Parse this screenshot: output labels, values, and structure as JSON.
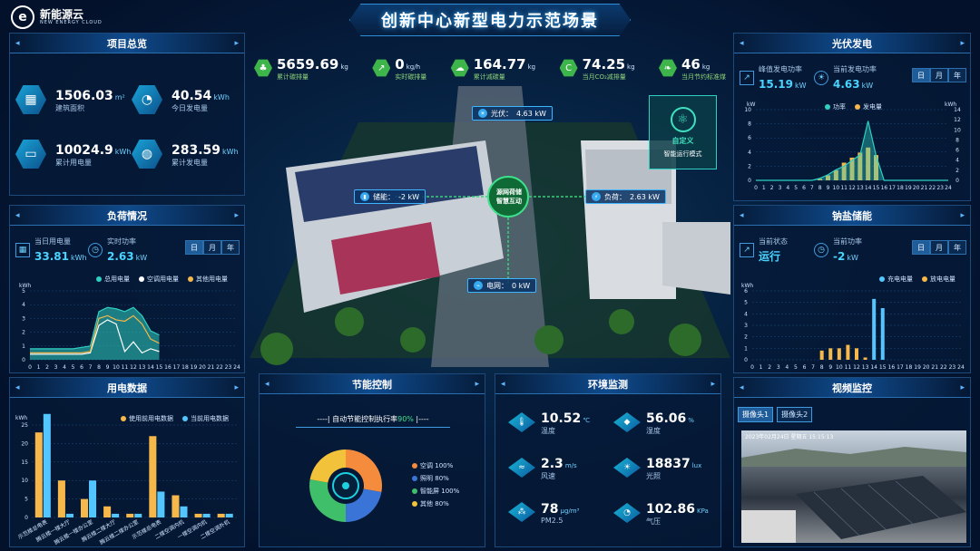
{
  "header": {
    "title": "创新中心新型电力示范场景",
    "logo_name": "新能源云",
    "logo_sub": "NEW ENERGY CLOUD"
  },
  "top_stats": [
    {
      "value": "5659.69",
      "unit": "kg",
      "label": "累计碳排量",
      "icon": "tree-icon"
    },
    {
      "value": "0",
      "unit": "kg/h",
      "label": "实时碳排量",
      "icon": "chart-icon"
    },
    {
      "value": "164.77",
      "unit": "kg",
      "label": "累计减碳量",
      "icon": "cloud-icon"
    },
    {
      "value": "74.25",
      "unit": "kg",
      "label": "当月CO₂减排量",
      "icon": "co2-icon"
    },
    {
      "value": "46",
      "unit": "kg",
      "label": "当月节约标准煤",
      "icon": "leaf-icon"
    }
  ],
  "project": {
    "title": "项目总览",
    "items": [
      {
        "value": "1506.03",
        "unit": "m²",
        "label": "建筑面积",
        "icon": "building-icon"
      },
      {
        "value": "40.54",
        "unit": "kWh",
        "label": "今日发电量",
        "icon": "meter-icon"
      },
      {
        "value": "10024.9",
        "unit": "kWh",
        "label": "累计用电量",
        "icon": "battery-icon"
      },
      {
        "value": "283.59",
        "unit": "kWh",
        "label": "累计发电量",
        "icon": "globe-icon"
      }
    ]
  },
  "load": {
    "title": "负荷情况",
    "today_label": "当日用电量",
    "today_value": "33.81",
    "today_unit": "kWh",
    "power_label": "实时功率",
    "power_value": "2.63",
    "power_unit": "kW",
    "tabs": [
      "日",
      "月",
      "年"
    ],
    "unit": "kWh",
    "legend": [
      "总用电量",
      "空调用电量",
      "其他用电量"
    ],
    "colors": [
      "#2fd0c2",
      "#ffffff",
      "#f6b84a"
    ]
  },
  "usage": {
    "title": "用电数据",
    "unit": "kWh",
    "legend": [
      "使用前用电数据",
      "当前用电数据"
    ],
    "colors": [
      "#f6b84a",
      "#53c6ff"
    ]
  },
  "control": {
    "title": "节能控制",
    "subtitle": "自动节能控制执行率",
    "rate": "90%",
    "items": [
      {
        "label": "空调",
        "value": "100%",
        "color": "#f58b3c"
      },
      {
        "label": "照明",
        "value": "80%",
        "color": "#3a74d6"
      },
      {
        "label": "智能屏",
        "value": "100%",
        "color": "#3fbf6a"
      },
      {
        "label": "其他",
        "value": "80%",
        "color": "#f2c23a"
      }
    ]
  },
  "env": {
    "title": "环境监测",
    "items": [
      {
        "value": "10.52",
        "unit": "℃",
        "label": "温度",
        "icon": "thermometer-icon"
      },
      {
        "value": "56.06",
        "unit": "%",
        "label": "湿度",
        "icon": "droplet-icon"
      },
      {
        "value": "2.3",
        "unit": "m/s",
        "label": "风速",
        "icon": "wind-icon"
      },
      {
        "value": "18837",
        "unit": "lux",
        "label": "光照",
        "icon": "sun-icon"
      },
      {
        "value": "78",
        "unit": "μg/m³",
        "label": "PM2.5",
        "icon": "dust-icon"
      },
      {
        "value": "102.86",
        "unit": "KPa",
        "label": "气压",
        "icon": "gauge-icon"
      }
    ]
  },
  "pv": {
    "title": "光伏发电",
    "peak_label": "峰值发电功率",
    "peak_value": "15.19",
    "peak_unit": "kW",
    "cur_label": "当前发电功率",
    "cur_value": "4.63",
    "cur_unit": "kW",
    "tabs": [
      "日",
      "月",
      "年"
    ],
    "unit_left": "kW",
    "unit_right": "kWh",
    "legend": [
      "功率",
      "发电量"
    ],
    "colors": [
      "#2fd0c2",
      "#f6b84a"
    ]
  },
  "storage": {
    "title": "钠盐储能",
    "state_label": "当前状态",
    "state_value": "运行",
    "power_label": "当前功率",
    "power_value": "-2",
    "power_unit": "kW",
    "tabs": [
      "日",
      "月",
      "年"
    ],
    "unit": "kWh",
    "legend": [
      "充电电量",
      "放电电量"
    ],
    "colors": [
      "#53c6ff",
      "#f6b84a"
    ]
  },
  "video": {
    "title": "视频监控",
    "tabs": [
      "摄像头1",
      "摄像头2"
    ],
    "timestamp": "2023年02月24日 星期五 15:15:13"
  },
  "scene": {
    "pv_label": "光伏：",
    "pv_value": "4.63 kW",
    "storage_label": "储能：",
    "storage_value": "-2 kW",
    "load_label": "负荷：",
    "load_value": "2.63 kW",
    "grid_label": "电网：",
    "grid_value": "0 kW",
    "center_line1": "源网荷储",
    "center_line2": "智慧互动",
    "mode_title": "自定义",
    "mode_label": "智能运行模式"
  },
  "chart_data": [
    {
      "type": "area",
      "title": "负荷情况",
      "ylabel": "kWh",
      "ylim": [
        0,
        5
      ],
      "x": [
        0,
        1,
        2,
        3,
        4,
        5,
        6,
        7,
        8,
        9,
        10,
        11,
        12,
        13,
        14,
        15
      ],
      "series": [
        {
          "name": "总用电量",
          "values": [
            0.8,
            0.8,
            0.8,
            0.8,
            0.8,
            0.8,
            0.9,
            1.0,
            3.5,
            3.8,
            3.7,
            3.5,
            3.8,
            3.2,
            2.1,
            1.8
          ]
        },
        {
          "name": "空调用电量",
          "values": [
            0.4,
            0.4,
            0.4,
            0.4,
            0.4,
            0.4,
            0.4,
            0.5,
            2.5,
            2.9,
            2.6,
            0.6,
            1.3,
            0.5,
            0.8,
            0.6
          ]
        },
        {
          "name": "其他用电量",
          "values": [
            0.5,
            0.5,
            0.5,
            0.5,
            0.5,
            0.5,
            0.5,
            0.6,
            3.0,
            3.2,
            2.9,
            2.8,
            3.2,
            2.6,
            1.5,
            1.2
          ]
        }
      ],
      "xticks": [
        "0",
        "1",
        "2",
        "3",
        "4",
        "5",
        "6",
        "7",
        "8",
        "9",
        "10",
        "11",
        "12",
        "13",
        "14",
        "15",
        "16",
        "17",
        "18",
        "19",
        "20",
        "21",
        "22",
        "23",
        "24"
      ]
    },
    {
      "type": "bar",
      "title": "用电数据",
      "ylabel": "kWh",
      "ylim": [
        0,
        25
      ],
      "categories": [
        "示范楼总电表",
        "腾云楼一楼大厅",
        "腾云楼一楼办公室",
        "腾云楼二楼大厅",
        "腾云楼二楼办公室",
        "示范楼总电表",
        "二楼空调内机",
        "一楼空调内机",
        "二楼空调外机"
      ],
      "series": [
        {
          "name": "使用前用电数据",
          "values": [
            23,
            10,
            5,
            3,
            1,
            22,
            6,
            1,
            1
          ]
        },
        {
          "name": "当前用电数据",
          "values": [
            28,
            1,
            10,
            1,
            1,
            7,
            3,
            1,
            1
          ]
        }
      ]
    },
    {
      "type": "bar",
      "title": "光伏发电",
      "ylabel": "kW",
      "ylim": [
        0,
        10
      ],
      "x": [
        0,
        1,
        2,
        3,
        4,
        5,
        6,
        7,
        8,
        9,
        10,
        11,
        12,
        13,
        14,
        15,
        16,
        17,
        18,
        19,
        20,
        21,
        22,
        23,
        24
      ],
      "series": [
        {
          "name": "功率",
          "values": [
            0,
            0,
            0,
            0,
            0,
            0,
            0,
            0,
            0.3,
            0.8,
            1.5,
            2.0,
            2.8,
            3.6,
            8.4,
            3.5,
            0,
            0,
            0,
            0,
            0,
            0,
            0,
            0,
            0
          ]
        },
        {
          "name": "发电量",
          "values": [
            0,
            0,
            0,
            0,
            0,
            0,
            0,
            0,
            0.3,
            1.0,
            2.0,
            3.5,
            4.5,
            5.5,
            6.5,
            5.0,
            0,
            0,
            0,
            0,
            0,
            0,
            0,
            0,
            0
          ]
        }
      ]
    },
    {
      "type": "bar",
      "title": "钠盐储能",
      "ylabel": "kWh",
      "ylim": [
        0,
        6
      ],
      "x": [
        0,
        1,
        2,
        3,
        4,
        5,
        6,
        7,
        8,
        9,
        10,
        11,
        12,
        13,
        14,
        15,
        16,
        17,
        18,
        19,
        20,
        21,
        22,
        23,
        24
      ],
      "series": [
        {
          "name": "充电电量",
          "values": [
            0,
            0,
            0,
            0,
            0,
            0,
            0,
            0,
            0,
            0,
            0,
            0,
            0,
            0,
            5.3,
            4.5,
            0,
            0,
            0,
            0,
            0,
            0,
            0,
            0,
            0
          ]
        },
        {
          "name": "放电电量",
          "values": [
            0,
            0,
            0,
            0,
            0,
            0,
            0,
            0,
            0.8,
            1.0,
            1.0,
            1.3,
            1.0,
            0.2,
            0,
            0,
            0,
            0,
            0,
            0,
            0,
            0,
            0,
            0,
            0
          ]
        }
      ]
    },
    {
      "type": "pie",
      "title": "节能控制",
      "categories": [
        "空调",
        "照明",
        "智能屏",
        "其他"
      ],
      "values": [
        100,
        80,
        100,
        80
      ]
    }
  ]
}
